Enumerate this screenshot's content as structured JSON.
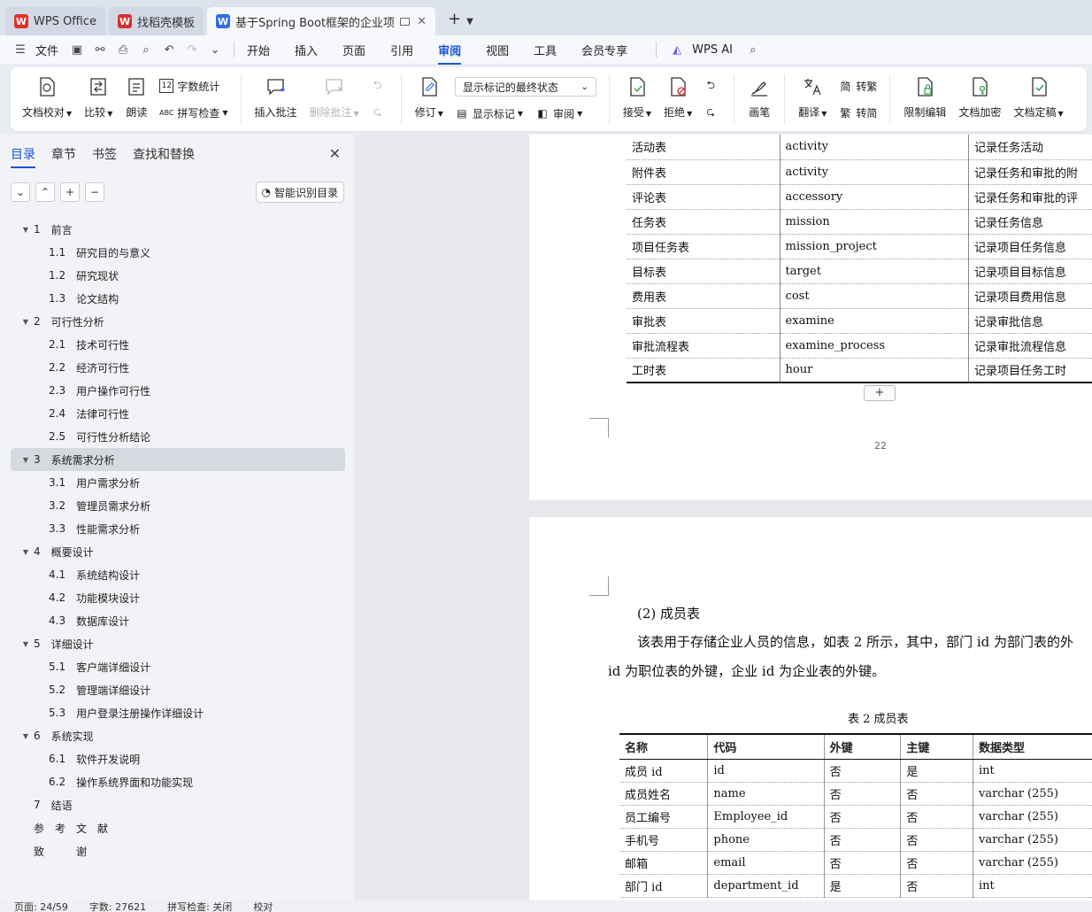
{
  "tabs": [
    {
      "label": "WPS Office",
      "logo_color": "#e0312b",
      "logo_char": "W"
    },
    {
      "label": "找稻壳模板",
      "logo_color": "#d6322f",
      "logo_char": "W"
    },
    {
      "label": "基于Spring Boot框架的企业项",
      "logo_color": "#2f6fe4",
      "logo_char": "W"
    }
  ],
  "menu": {
    "file": "文件",
    "items": [
      "开始",
      "插入",
      "页面",
      "引用",
      "审阅",
      "视图",
      "工具",
      "会员专享"
    ],
    "active": "审阅",
    "ai": "WPS AI"
  },
  "ribbon": {
    "doc_check": "文档校对",
    "compare": "比较",
    "read_aloud": "朗读",
    "word_count": "字数统计",
    "spell_check": "拼写检查",
    "insert_comment": "插入批注",
    "delete_comment": "删除批注",
    "revise": "修订",
    "markup_state": "显示标记的最终状态",
    "show_markup": "显示标记",
    "review": "审阅",
    "accept": "接受",
    "reject": "拒绝",
    "pen": "画笔",
    "translate": "翻译",
    "to_traditional": "转繁",
    "to_simplified": "转简",
    "restrict_edit": "限制编辑",
    "encrypt": "文档加密",
    "finalize": "文档定稿"
  },
  "nav": {
    "tabs": [
      "目录",
      "章节",
      "书签",
      "查找和替换"
    ],
    "smart_toc": "智能识别目录",
    "toc": [
      {
        "num": "1",
        "text": "前言",
        "level": 1,
        "expand": true
      },
      {
        "num": "1.1",
        "text": "研究目的与意义",
        "level": 2
      },
      {
        "num": "1.2",
        "text": "研究现状",
        "level": 2
      },
      {
        "num": "1.3",
        "text": "论文结构",
        "level": 2
      },
      {
        "num": "2",
        "text": "可行性分析",
        "level": 1,
        "expand": true
      },
      {
        "num": "2.1",
        "text": "技术可行性",
        "level": 2
      },
      {
        "num": "2.2",
        "text": "经济可行性",
        "level": 2
      },
      {
        "num": "2.3",
        "text": "用户操作可行性",
        "level": 2
      },
      {
        "num": "2.4",
        "text": "法律可行性",
        "level": 2
      },
      {
        "num": "2.5",
        "text": "可行性分析结论",
        "level": 2
      },
      {
        "num": "3",
        "text": "系统需求分析",
        "level": 1,
        "expand": true,
        "selected": true
      },
      {
        "num": "3.1",
        "text": "用户需求分析",
        "level": 2
      },
      {
        "num": "3.2",
        "text": "管理员需求分析",
        "level": 2
      },
      {
        "num": "3.3",
        "text": "性能需求分析",
        "level": 2
      },
      {
        "num": "4",
        "text": "概要设计",
        "level": 1,
        "expand": true
      },
      {
        "num": "4.1",
        "text": "系统结构设计",
        "level": 2
      },
      {
        "num": "4.2",
        "text": "功能模块设计",
        "level": 2
      },
      {
        "num": "4.3",
        "text": "数据库设计",
        "level": 2
      },
      {
        "num": "5",
        "text": "详细设计",
        "level": 1,
        "expand": true
      },
      {
        "num": "5.1",
        "text": "客户端详细设计",
        "level": 2
      },
      {
        "num": "5.2",
        "text": "管理端详细设计",
        "level": 2
      },
      {
        "num": "5.3",
        "text": "用户登录注册操作详细设计",
        "level": 2
      },
      {
        "num": "6",
        "text": "系统实现",
        "level": 1,
        "expand": true
      },
      {
        "num": "6.1",
        "text": "软件开发说明",
        "level": 2
      },
      {
        "num": "6.2",
        "text": "操作系统界面和功能实现",
        "level": 2
      },
      {
        "num": "7",
        "text": "结语",
        "level": 1,
        "expand": false
      },
      {
        "num": "",
        "text": "参　考　文　献",
        "level": 1,
        "expand": false
      },
      {
        "num": "",
        "text": "致　　　谢",
        "level": 1,
        "expand": false
      }
    ]
  },
  "page1": {
    "rows": [
      [
        "活动表",
        "activity",
        "记录任务活动"
      ],
      [
        "附件表",
        "activity",
        "记录任务和审批的附"
      ],
      [
        "评论表",
        "accessory",
        "记录任务和审批的评"
      ],
      [
        "任务表",
        "mission",
        "记录任务信息"
      ],
      [
        "项目任务表",
        "mission_project",
        "记录项目任务信息"
      ],
      [
        "目标表",
        "target",
        "记录项目目标信息"
      ],
      [
        "费用表",
        "cost",
        "记录项目费用信息"
      ],
      [
        "审批表",
        "examine",
        "记录审批信息"
      ],
      [
        "审批流程表",
        "examine_process",
        "记录审批流程信息"
      ],
      [
        "工时表",
        "hour",
        "记录项目任务工时"
      ]
    ],
    "add_row": "+",
    "page_number": "22"
  },
  "page2": {
    "heading": "(2)  成员表",
    "para_line1": "该表用于存储企业人员的信息，如表 2 所示，其中，部门 id 为部门表的外",
    "para_line2": "id 为职位表的外键，企业 id 为企业表的外键。",
    "caption": "表 2  成员表",
    "headers": [
      "名称",
      "代码",
      "外键",
      "主键",
      "数据类型"
    ],
    "rows": [
      [
        "成员 id",
        "id",
        "否",
        "是",
        "int"
      ],
      [
        "成员姓名",
        "name",
        "否",
        "否",
        "varchar (255)"
      ],
      [
        "员工编号",
        "Employee_id",
        "否",
        "否",
        "varchar (255)"
      ],
      [
        "手机号",
        "phone",
        "否",
        "否",
        "varchar (255)"
      ],
      [
        "邮箱",
        "email",
        "否",
        "否",
        "varchar (255)"
      ],
      [
        "部门 id",
        "department_id",
        "是",
        "否",
        "int"
      ]
    ]
  },
  "status": {
    "page": "页面: 24/59",
    "words": "字数: 27621",
    "spell": "拼写检查: 关闭",
    "proof": "校对"
  }
}
